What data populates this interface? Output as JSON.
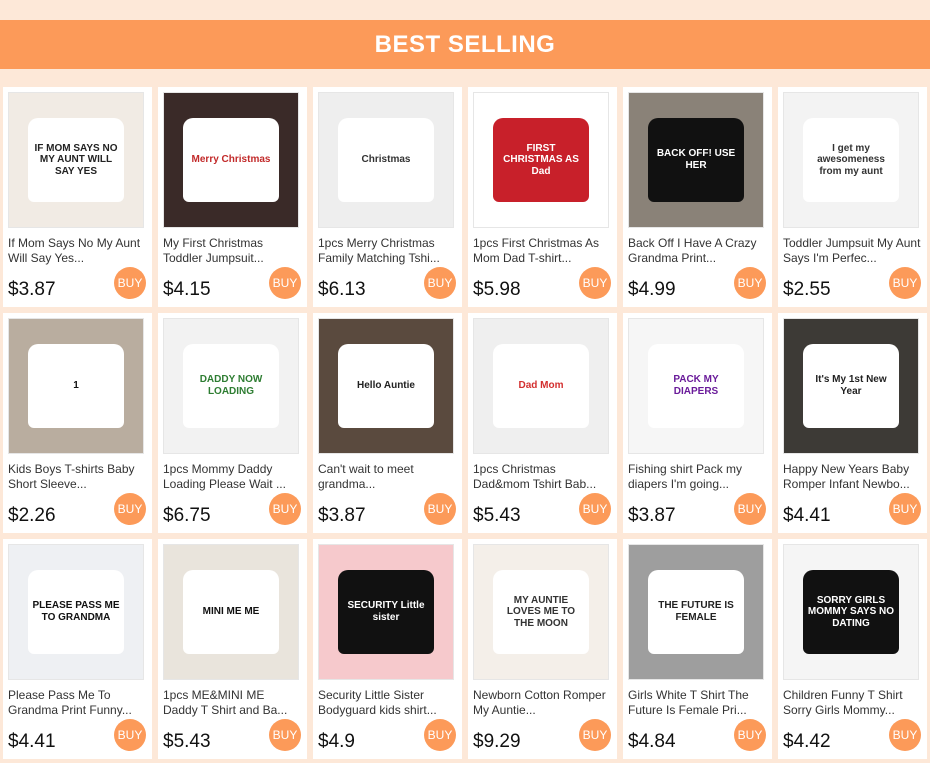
{
  "banner": {
    "title": "BEST SELLING"
  },
  "colors": {
    "accent": "#fc9a59",
    "background": "#fde8d8"
  },
  "products": [
    {
      "title": "If Mom Says No My Aunt Will Say Yes...",
      "price": "$3.87",
      "buy": "BUY",
      "img_bg": "#f1ebe4",
      "shirt_bg": "#ffffff",
      "shirt_fg": "#222222",
      "img_text": "IF MOM SAYS NO MY AUNT WILL SAY YES"
    },
    {
      "title": "My First Christmas Toddler Jumpsuit...",
      "price": "$4.15",
      "buy": "BUY",
      "img_bg": "#3a2a28",
      "shirt_bg": "#ffffff",
      "shirt_fg": "#c22a2a",
      "img_text": "Merry Christmas"
    },
    {
      "title": "1pcs Merry Christmas Family Matching Tshi...",
      "price": "$6.13",
      "buy": "BUY",
      "img_bg": "#eeeeee",
      "shirt_bg": "#ffffff",
      "shirt_fg": "#333333",
      "img_text": "Christmas"
    },
    {
      "title": "1pcs First Christmas As Mom Dad T-shirt...",
      "price": "$5.98",
      "buy": "BUY",
      "img_bg": "#ffffff",
      "shirt_bg": "#c8202a",
      "shirt_fg": "#ffffff",
      "img_text": "FIRST CHRISTMAS AS Dad"
    },
    {
      "title": "Back Off I Have A Crazy Grandma Print...",
      "price": "$4.99",
      "buy": "BUY",
      "img_bg": "#8a8278",
      "shirt_bg": "#111111",
      "shirt_fg": "#ffffff",
      "img_text": "BACK OFF! USE HER"
    },
    {
      "title": "Toddler Jumpsuit My Aunt Says I'm Perfec...",
      "price": "$2.55",
      "buy": "BUY",
      "img_bg": "#f3f3f3",
      "shirt_bg": "#ffffff",
      "shirt_fg": "#333333",
      "img_text": "I get my awesomeness from my aunt"
    },
    {
      "title": "Kids Boys T-shirts Baby Short Sleeve...",
      "price": "$2.26",
      "buy": "BUY",
      "img_bg": "#b9ad9f",
      "shirt_bg": "#ffffff",
      "shirt_fg": "#111111",
      "img_text": "1"
    },
    {
      "title": "1pcs Mommy Daddy Loading Please Wait ...",
      "price": "$6.75",
      "buy": "BUY",
      "img_bg": "#f2f2f2",
      "shirt_bg": "#ffffff",
      "shirt_fg": "#2e7d32",
      "img_text": "DADDY NOW LOADING"
    },
    {
      "title": "Can't wait to meet grandma...",
      "price": "$3.87",
      "buy": "BUY",
      "img_bg": "#5a4a3e",
      "shirt_bg": "#ffffff",
      "shirt_fg": "#222222",
      "img_text": "Hello Auntie"
    },
    {
      "title": "1pcs Christmas Dad&mom Tshirt Bab...",
      "price": "$5.43",
      "buy": "BUY",
      "img_bg": "#efefef",
      "shirt_bg": "#ffffff",
      "shirt_fg": "#d32f2f",
      "img_text": "Dad Mom"
    },
    {
      "title": "Fishing shirt Pack my diapers I'm going...",
      "price": "$3.87",
      "buy": "BUY",
      "img_bg": "#f6f6f6",
      "shirt_bg": "#ffffff",
      "shirt_fg": "#6a1b9a",
      "img_text": "PACK MY DIAPERS"
    },
    {
      "title": "Happy New Years Baby Romper Infant Newbo...",
      "price": "$4.41",
      "buy": "BUY",
      "img_bg": "#3d3a36",
      "shirt_bg": "#ffffff",
      "shirt_fg": "#222222",
      "img_text": "It's My 1st New Year"
    },
    {
      "title": "Please Pass Me To Grandma Print Funny...",
      "price": "$4.41",
      "buy": "BUY",
      "img_bg": "#eef0f3",
      "shirt_bg": "#ffffff",
      "shirt_fg": "#111111",
      "img_text": "PLEASE PASS ME TO GRANDMA"
    },
    {
      "title": "1pcs ME&MINI ME Daddy T Shirt and Ba...",
      "price": "$5.43",
      "buy": "BUY",
      "img_bg": "#e9e4dc",
      "shirt_bg": "#ffffff",
      "shirt_fg": "#111111",
      "img_text": "MINI ME ME"
    },
    {
      "title": "Security Little Sister Bodyguard kids shirt...",
      "price": "$4.9",
      "buy": "BUY",
      "img_bg": "#f6c9cc",
      "shirt_bg": "#111111",
      "shirt_fg": "#ffffff",
      "img_text": "SECURITY Little sister"
    },
    {
      "title": "Newborn Cotton Romper My Auntie...",
      "price": "$9.29",
      "buy": "BUY",
      "img_bg": "#f4efe9",
      "shirt_bg": "#ffffff",
      "shirt_fg": "#333333",
      "img_text": "MY AUNTIE LOVES ME TO THE MOON"
    },
    {
      "title": "Girls White T Shirt The Future Is Female Pri...",
      "price": "$4.84",
      "buy": "BUY",
      "img_bg": "#9e9e9e",
      "shirt_bg": "#ffffff",
      "shirt_fg": "#222222",
      "img_text": "THE FUTURE IS FEMALE"
    },
    {
      "title": "Children Funny T Shirt Sorry Girls Mommy...",
      "price": "$4.42",
      "buy": "BUY",
      "img_bg": "#f5f5f5",
      "shirt_bg": "#111111",
      "shirt_fg": "#ffffff",
      "img_text": "SORRY GIRLS MOMMY SAYS NO DATING"
    }
  ]
}
